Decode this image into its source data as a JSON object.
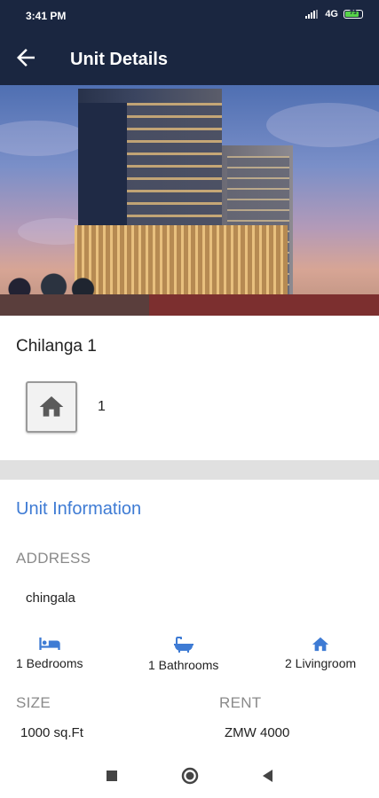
{
  "status_bar": {
    "time": "3:41 PM",
    "network": "4G",
    "battery": "73"
  },
  "app_bar": {
    "title": "Unit Details",
    "back_icon": "arrow-left-icon"
  },
  "unit": {
    "name": "Chilanga 1",
    "home_icon": "home-icon",
    "count": "1"
  },
  "unit_information": {
    "section_title": "Unit Information",
    "address_label": "ADDRESS",
    "address_value": "chingala",
    "features": [
      {
        "icon": "bed-icon",
        "label": "1 Bedrooms"
      },
      {
        "icon": "bathtub-icon",
        "label": "1 Bathrooms"
      },
      {
        "icon": "home-icon",
        "label": "2 Livingroom"
      }
    ],
    "size_label": "SIZE",
    "size_value": "1000 sq.Ft",
    "rent_label": "RENT",
    "rent_value": "ZMW 4000"
  },
  "nav": {
    "recents_icon": "square-icon",
    "home_icon": "circle-icon",
    "back_icon": "triangle-back-icon"
  },
  "colors": {
    "app_bar": "#1a2640",
    "accent": "#3e7bd4",
    "label_gray": "#8a8a8a",
    "divider": "#e0e0e0"
  }
}
